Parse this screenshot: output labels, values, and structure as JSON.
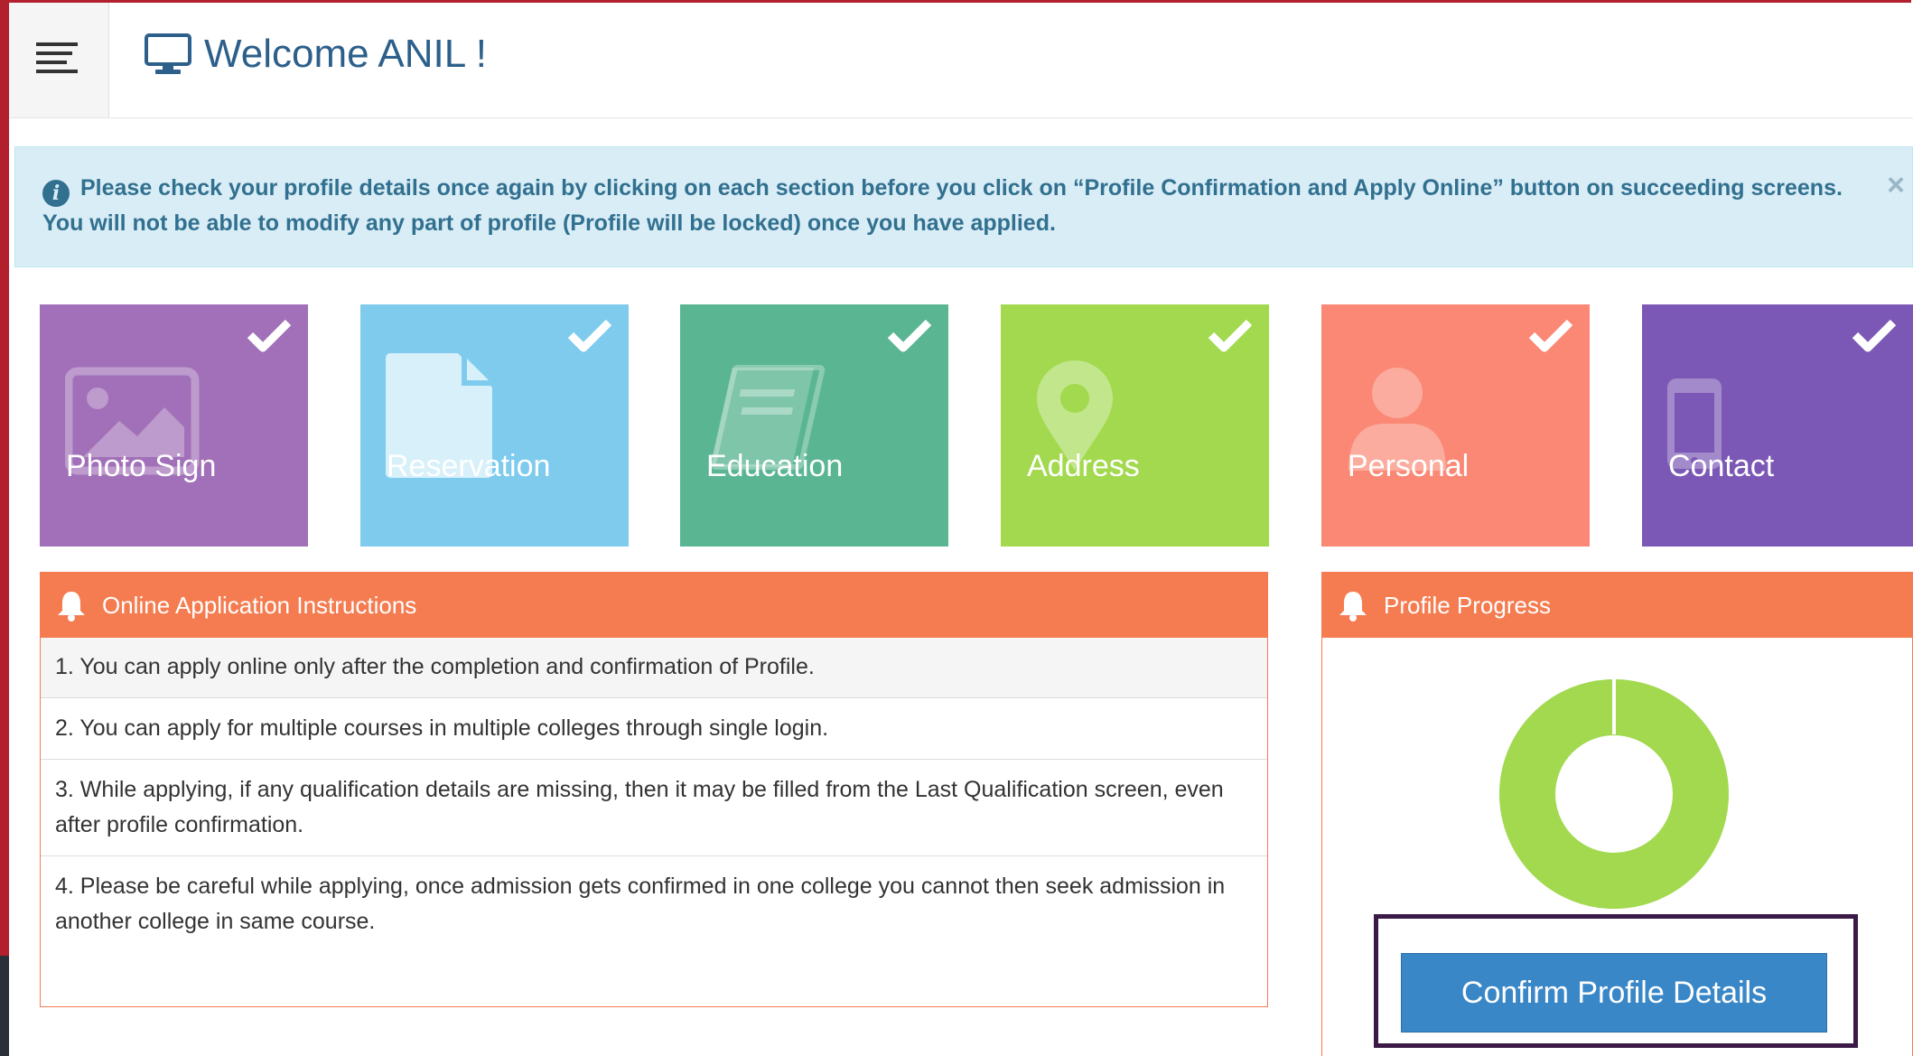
{
  "header": {
    "menu_icon": "hamburger-menu-icon",
    "title_icon": "desktop-monitor-icon",
    "title": "Welcome ANIL !"
  },
  "alert": {
    "icon": "info-circle-icon",
    "message": "Please check your profile details once again by clicking on each section before you click on “Profile Confirmation and Apply Online” button on succeeding screens. You will not be able to modify any part of profile (Profile will be locked) once you have applied.",
    "close_label": "×"
  },
  "tiles": [
    {
      "label": "Photo Sign",
      "icon": "image-icon",
      "color": "#a170b8",
      "completed": true
    },
    {
      "label": "Reservation",
      "icon": "document-icon",
      "color": "#7ecbee",
      "completed": true
    },
    {
      "label": "Education",
      "icon": "book-icon",
      "color": "#5ab593",
      "completed": true
    },
    {
      "label": "Address",
      "icon": "map-marker-icon",
      "color": "#a2d94e",
      "completed": true
    },
    {
      "label": "Personal",
      "icon": "user-icon",
      "color": "#fa8875",
      "completed": true
    },
    {
      "label": "Contact",
      "icon": "mobile-phone-icon",
      "color": "#7b58b5",
      "completed": true
    }
  ],
  "instructions": {
    "title": "Online Application Instructions",
    "icon": "bell-icon",
    "items": [
      "1. You can apply online only after the completion and confirmation of Profile.",
      "2. You can apply for multiple courses in multiple colleges through single login.",
      "3. While applying, if any qualification details are missing, then it may be filled from the Last Qualification screen, even after profile confirmation.",
      "4. Please be careful while applying, once admission gets confirmed in one college you cannot then seek admission in another college in same course."
    ]
  },
  "progress": {
    "title": "Profile Progress",
    "icon": "bell-icon",
    "completion_fraction": 1.0,
    "ring_color": "#a2d94e",
    "confirm_label": "Confirm Profile Details"
  },
  "colors": {
    "alert_bg": "#d9edf7",
    "panel_header": "#f47c50",
    "button_primary": "#3a87c8"
  }
}
